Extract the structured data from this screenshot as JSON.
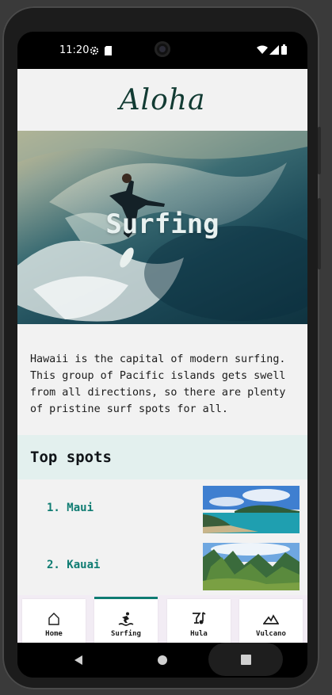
{
  "status_bar": {
    "time": "11:20",
    "icons": [
      "settings-gear-icon",
      "sd-card-icon",
      "wifi-icon",
      "cell-signal-icon",
      "battery-icon"
    ]
  },
  "app_bar": {
    "title": "Aloha"
  },
  "hero": {
    "title": "Surfing"
  },
  "intro": {
    "text": "Hawaii is the capital of modern surfing. This group of Pacific islands gets swell from all directions, so there are plenty of pristine surf spots for all."
  },
  "top_spots": {
    "title": "Top spots",
    "items": [
      {
        "label": "1. Maui"
      },
      {
        "label": "2. Kauai"
      }
    ]
  },
  "bottom_nav": {
    "items": [
      {
        "label": "Home",
        "icon": "home-icon",
        "active": false
      },
      {
        "label": "Surfing",
        "icon": "surfing-icon",
        "active": true
      },
      {
        "label": "Hula",
        "icon": "hula-icon",
        "active": false
      },
      {
        "label": "Vulcano",
        "icon": "vulcano-icon",
        "active": false
      }
    ]
  },
  "colors": {
    "accent": "#0f7c72",
    "title": "#123b33",
    "section_bg": "#e3f0ee",
    "nav_bg": "#f2ecf4"
  }
}
